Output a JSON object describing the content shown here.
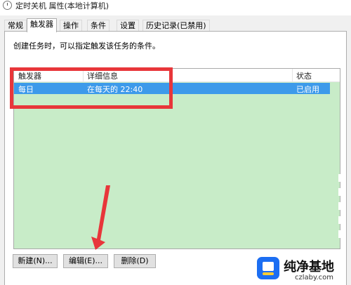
{
  "window": {
    "title": "定时关机 属性(本地计算机)"
  },
  "tabs": [
    {
      "label": "常规"
    },
    {
      "label": "触发器"
    },
    {
      "label": "操作"
    },
    {
      "label": "条件"
    },
    {
      "label": "设置"
    },
    {
      "label": "历史记录(已禁用)"
    }
  ],
  "description": "创建任务时，可以指定触发该任务的条件。",
  "list": {
    "columns": [
      "触发器",
      "详细信息",
      "状态"
    ],
    "rows": [
      {
        "trigger": "每日",
        "details": "在每天的 22:40",
        "status": "已启用"
      }
    ]
  },
  "buttons": {
    "new": "新建(N)...",
    "edit": "编辑(E)...",
    "delete": "删除(D)"
  },
  "colors": {
    "selection": "#3d9aea",
    "list_bg": "#c8ecc8",
    "highlight_box": "#e8363a",
    "arrow": "#e8363a"
  },
  "watermark": {
    "text": "纯净基地",
    "url": "czlaby.com"
  }
}
